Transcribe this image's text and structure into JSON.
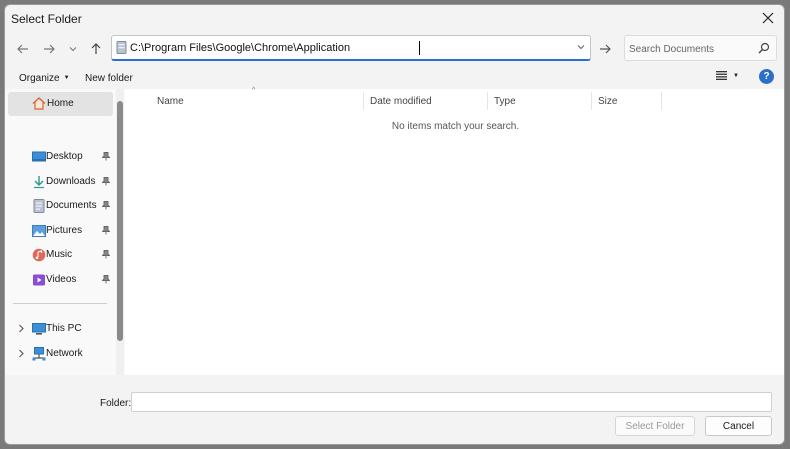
{
  "window": {
    "title": "Select Folder"
  },
  "address": {
    "path": "C:\\Program Files\\Google\\Chrome\\Application",
    "search_placeholder": "Search Documents"
  },
  "toolbar": {
    "organize_label": "Organize",
    "new_folder_label": "New folder"
  },
  "nav": {
    "home_label": "Home",
    "quick_access": [
      {
        "label": "Desktop",
        "icon": "desktop-icon"
      },
      {
        "label": "Downloads",
        "icon": "downloads-icon"
      },
      {
        "label": "Documents",
        "icon": "documents-icon"
      },
      {
        "label": "Pictures",
        "icon": "pictures-icon"
      },
      {
        "label": "Music",
        "icon": "music-icon"
      },
      {
        "label": "Videos",
        "icon": "videos-icon"
      }
    ],
    "locations": [
      {
        "label": "This PC",
        "icon": "this-pc-icon"
      },
      {
        "label": "Network",
        "icon": "network-icon"
      }
    ]
  },
  "columns": {
    "name": "Name",
    "date_modified": "Date modified",
    "type": "Type",
    "size": "Size"
  },
  "content": {
    "empty_message": "No items match your search."
  },
  "footer": {
    "folder_label": "Folder:",
    "folder_value": "",
    "select_button": "Select Folder",
    "cancel_button": "Cancel"
  },
  "colors": {
    "accent": "#2a6fd1",
    "help": "#2c6fc9"
  }
}
